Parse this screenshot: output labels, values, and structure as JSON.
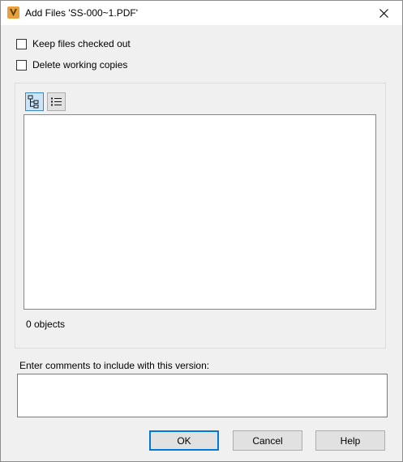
{
  "window": {
    "title": "Add Files 'SS-000~1.PDF'",
    "app_icon": "vault-v-icon",
    "accent_color": "#e8a13a"
  },
  "options": {
    "keep_checked_out": {
      "label": "Keep files checked out",
      "checked": false
    },
    "delete_working_copies": {
      "label": "Delete working copies",
      "checked": false
    }
  },
  "view_toolbar": {
    "tree_view": {
      "icon": "tree-view-icon",
      "active": true
    },
    "list_view": {
      "icon": "list-view-icon",
      "active": false
    }
  },
  "files": {
    "items": [],
    "count_text": "0 objects"
  },
  "comments": {
    "label": "Enter comments to include with this version:",
    "value": ""
  },
  "buttons": {
    "ok": "OK",
    "cancel": "Cancel",
    "help": "Help"
  }
}
